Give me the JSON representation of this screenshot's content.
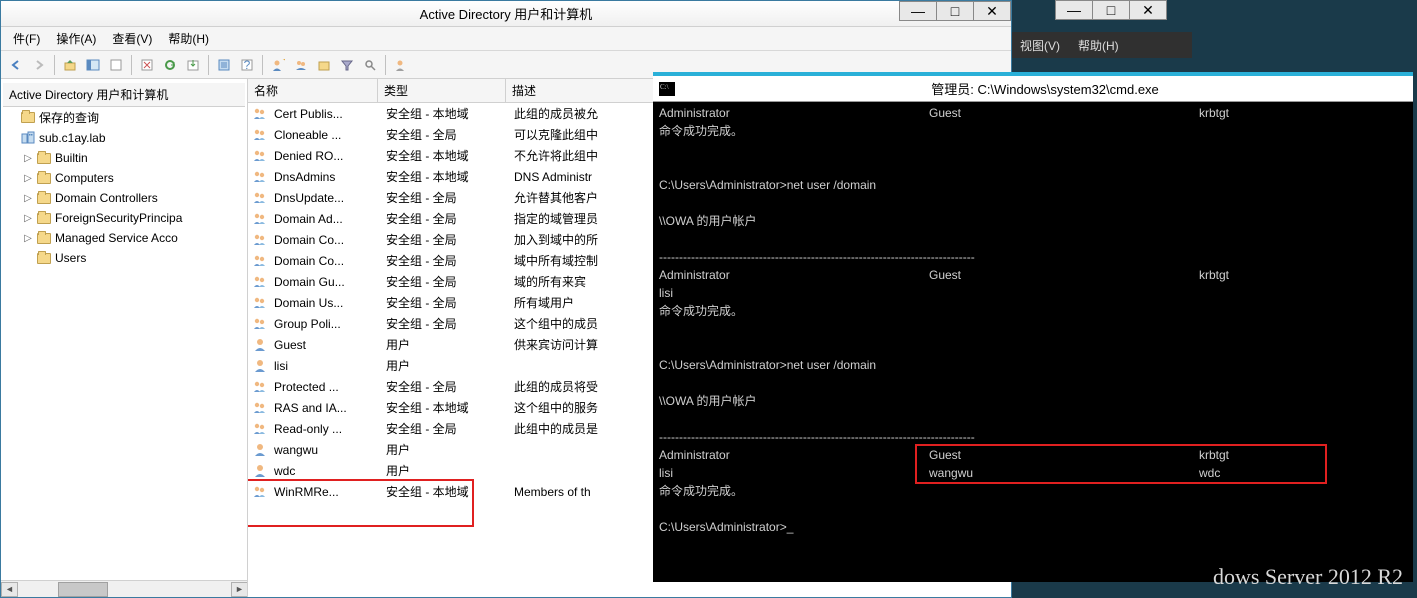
{
  "ad": {
    "title": "Active Directory 用户和计算机",
    "menu": {
      "file": "件(F)",
      "action": "操作(A)",
      "view": "查看(V)",
      "help": "帮助(H)"
    },
    "tree_header": "Active Directory 用户和计算机",
    "tree": [
      {
        "label": "保存的查询",
        "icon": "folder",
        "indent": 0,
        "exp": ""
      },
      {
        "label": "sub.c1ay.lab",
        "icon": "domain",
        "indent": 0,
        "exp": ""
      },
      {
        "label": "Builtin",
        "icon": "folder",
        "indent": 1,
        "exp": "▷"
      },
      {
        "label": "Computers",
        "icon": "folder",
        "indent": 1,
        "exp": "▷"
      },
      {
        "label": "Domain Controllers",
        "icon": "folder",
        "indent": 1,
        "exp": "▷"
      },
      {
        "label": "ForeignSecurityPrincipa",
        "icon": "folder",
        "indent": 1,
        "exp": "▷"
      },
      {
        "label": "Managed Service Acco",
        "icon": "folder",
        "indent": 1,
        "exp": "▷"
      },
      {
        "label": "Users",
        "icon": "folder",
        "indent": 1,
        "exp": ""
      }
    ],
    "cols": {
      "name": "名称",
      "type": "类型",
      "desc": "描述"
    },
    "rows": [
      {
        "name": "Cert Publis...",
        "type": "安全组 - 本地域",
        "desc": "此组的成员被允",
        "icon": "grp"
      },
      {
        "name": "Cloneable ...",
        "type": "安全组 - 全局",
        "desc": "可以克隆此组中",
        "icon": "grp"
      },
      {
        "name": "Denied RO...",
        "type": "安全组 - 本地域",
        "desc": "不允许将此组中",
        "icon": "grp"
      },
      {
        "name": "DnsAdmins",
        "type": "安全组 - 本地域",
        "desc": "DNS Administr",
        "icon": "grp"
      },
      {
        "name": "DnsUpdate...",
        "type": "安全组 - 全局",
        "desc": "允许替其他客户",
        "icon": "grp"
      },
      {
        "name": "Domain Ad...",
        "type": "安全组 - 全局",
        "desc": "指定的域管理员",
        "icon": "grp"
      },
      {
        "name": "Domain Co...",
        "type": "安全组 - 全局",
        "desc": "加入到域中的所",
        "icon": "grp"
      },
      {
        "name": "Domain Co...",
        "type": "安全组 - 全局",
        "desc": "域中所有域控制",
        "icon": "grp"
      },
      {
        "name": "Domain Gu...",
        "type": "安全组 - 全局",
        "desc": "域的所有来宾",
        "icon": "grp"
      },
      {
        "name": "Domain Us...",
        "type": "安全组 - 全局",
        "desc": "所有域用户",
        "icon": "grp"
      },
      {
        "name": "Group Poli...",
        "type": "安全组 - 全局",
        "desc": "这个组中的成员",
        "icon": "grp"
      },
      {
        "name": "Guest",
        "type": "用户",
        "desc": "供来宾访问计算",
        "icon": "usr"
      },
      {
        "name": "lisi",
        "type": "用户",
        "desc": "",
        "icon": "usr"
      },
      {
        "name": "Protected ...",
        "type": "安全组 - 全局",
        "desc": "此组的成员将受",
        "icon": "grp"
      },
      {
        "name": "RAS and IA...",
        "type": "安全组 - 本地域",
        "desc": "这个组中的服务",
        "icon": "grp"
      },
      {
        "name": "Read-only ...",
        "type": "安全组 - 全局",
        "desc": "此组中的成员是",
        "icon": "grp"
      },
      {
        "name": "wangwu",
        "type": "用户",
        "desc": "",
        "icon": "usr"
      },
      {
        "name": "wdc",
        "type": "用户",
        "desc": "",
        "icon": "usr"
      },
      {
        "name": "WinRMRe...",
        "type": "安全组 - 本地域",
        "desc": "Members of th",
        "icon": "grp"
      }
    ]
  },
  "bg": {
    "view": "视图(V)",
    "help": "帮助(H)"
  },
  "cmd": {
    "title": "管理员: C:\\Windows\\system32\\cmd.exe",
    "l1a": "Administrator",
    "l1b": "Guest",
    "l1c": "krbtgt",
    "l2": "命令成功完成。",
    "l4": "C:\\Users\\Administrator>net user /domain",
    "l6": "\\\\OWA 的用户帐户",
    "l9a": "Administrator",
    "l9b": "Guest",
    "l9c": "krbtgt",
    "l10": "lisi",
    "l11": "命令成功完成。",
    "l13": "C:\\Users\\Administrator>net user /domain",
    "l15": "\\\\OWA 的用户帐户",
    "l18a": "Administrator",
    "l18b": "Guest",
    "l18c": "krbtgt",
    "l19a": "lisi",
    "l19b": "wangwu",
    "l19c": "wdc",
    "l20": "命令成功完成。",
    "l22": "C:\\Users\\Administrator>_"
  },
  "watermark": "dows Server 2012 R2"
}
